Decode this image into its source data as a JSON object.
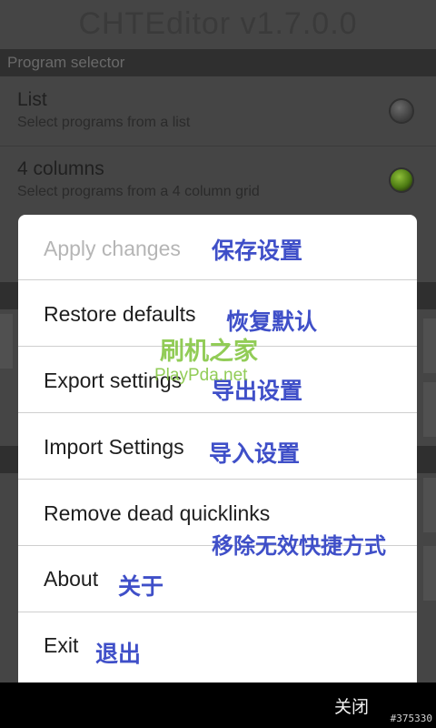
{
  "app": {
    "title": "CHTEditor v1.7.0.0"
  },
  "background": {
    "section_header": "Program selector",
    "options": [
      {
        "title": "List",
        "summary": "Select programs from a list",
        "checked": false
      },
      {
        "title": "4 columns",
        "summary": "Select programs from a 4 column grid",
        "checked": true
      }
    ]
  },
  "menu": {
    "items": [
      {
        "label": "Apply changes",
        "annotation": "保存设置",
        "enabled": false
      },
      {
        "label": "Restore defaults",
        "annotation": "恢复默认",
        "enabled": true
      },
      {
        "label": "Export settings",
        "annotation": "导出设置",
        "enabled": true
      },
      {
        "label": "Import Settings",
        "annotation": "导入设置",
        "enabled": true
      },
      {
        "label": "Remove dead quicklinks",
        "annotation": "移除无效快捷方式",
        "enabled": true
      },
      {
        "label": "About",
        "annotation": "关于",
        "enabled": true
      },
      {
        "label": "Exit",
        "annotation": "退出",
        "enabled": true
      }
    ]
  },
  "watermark": {
    "line1": "刷机之家",
    "line2": "PlayPda.net"
  },
  "bottom_bar": {
    "close_label": "关闭",
    "image_id": "#375330"
  },
  "colors": {
    "annotation": "#3f4fc8",
    "watermark": "#7fc43a",
    "radio_checked": "#6fa82a"
  }
}
